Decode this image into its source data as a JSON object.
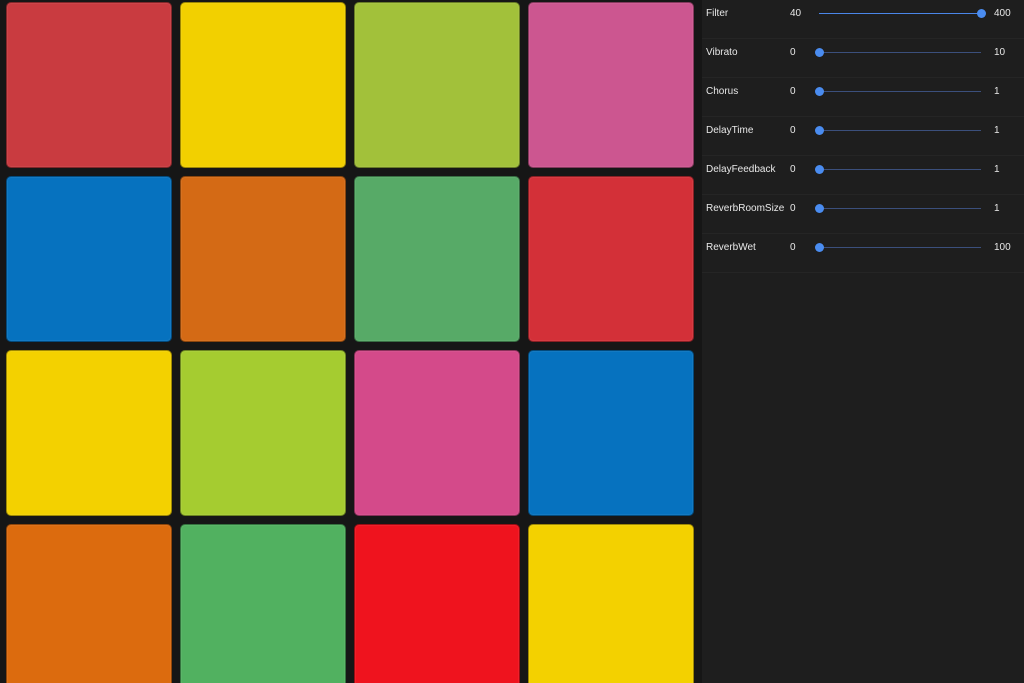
{
  "pads": [
    {
      "color": "#c93b40"
    },
    {
      "color": "#f2d000"
    },
    {
      "color": "#a2c13a"
    },
    {
      "color": "#cc5690"
    },
    {
      "color": "#0672bf"
    },
    {
      "color": "#d46a15"
    },
    {
      "color": "#57aa67"
    },
    {
      "color": "#d33038"
    },
    {
      "color": "#f3d100"
    },
    {
      "color": "#a5cc30"
    },
    {
      "color": "#d44a8a"
    },
    {
      "color": "#0672bf"
    },
    {
      "color": "#dc6b0e"
    },
    {
      "color": "#51b160"
    },
    {
      "color": "#ef131e"
    },
    {
      "color": "#f3d100"
    }
  ],
  "controls": [
    {
      "label": "Filter",
      "min": "40",
      "max": "400",
      "level": 1.0
    },
    {
      "label": "Vibrato",
      "min": "0",
      "max": "10",
      "level": 0.0
    },
    {
      "label": "Chorus",
      "min": "0",
      "max": "1",
      "level": 0.0
    },
    {
      "label": "DelayTime",
      "min": "0",
      "max": "1",
      "level": 0.0
    },
    {
      "label": "DelayFeedback",
      "min": "0",
      "max": "1",
      "level": 0.0
    },
    {
      "label": "ReverbRoomSize",
      "min": "0",
      "max": "1",
      "level": 0.0
    },
    {
      "label": "ReverbWet",
      "min": "0",
      "max": "100",
      "level": 0.0
    }
  ]
}
